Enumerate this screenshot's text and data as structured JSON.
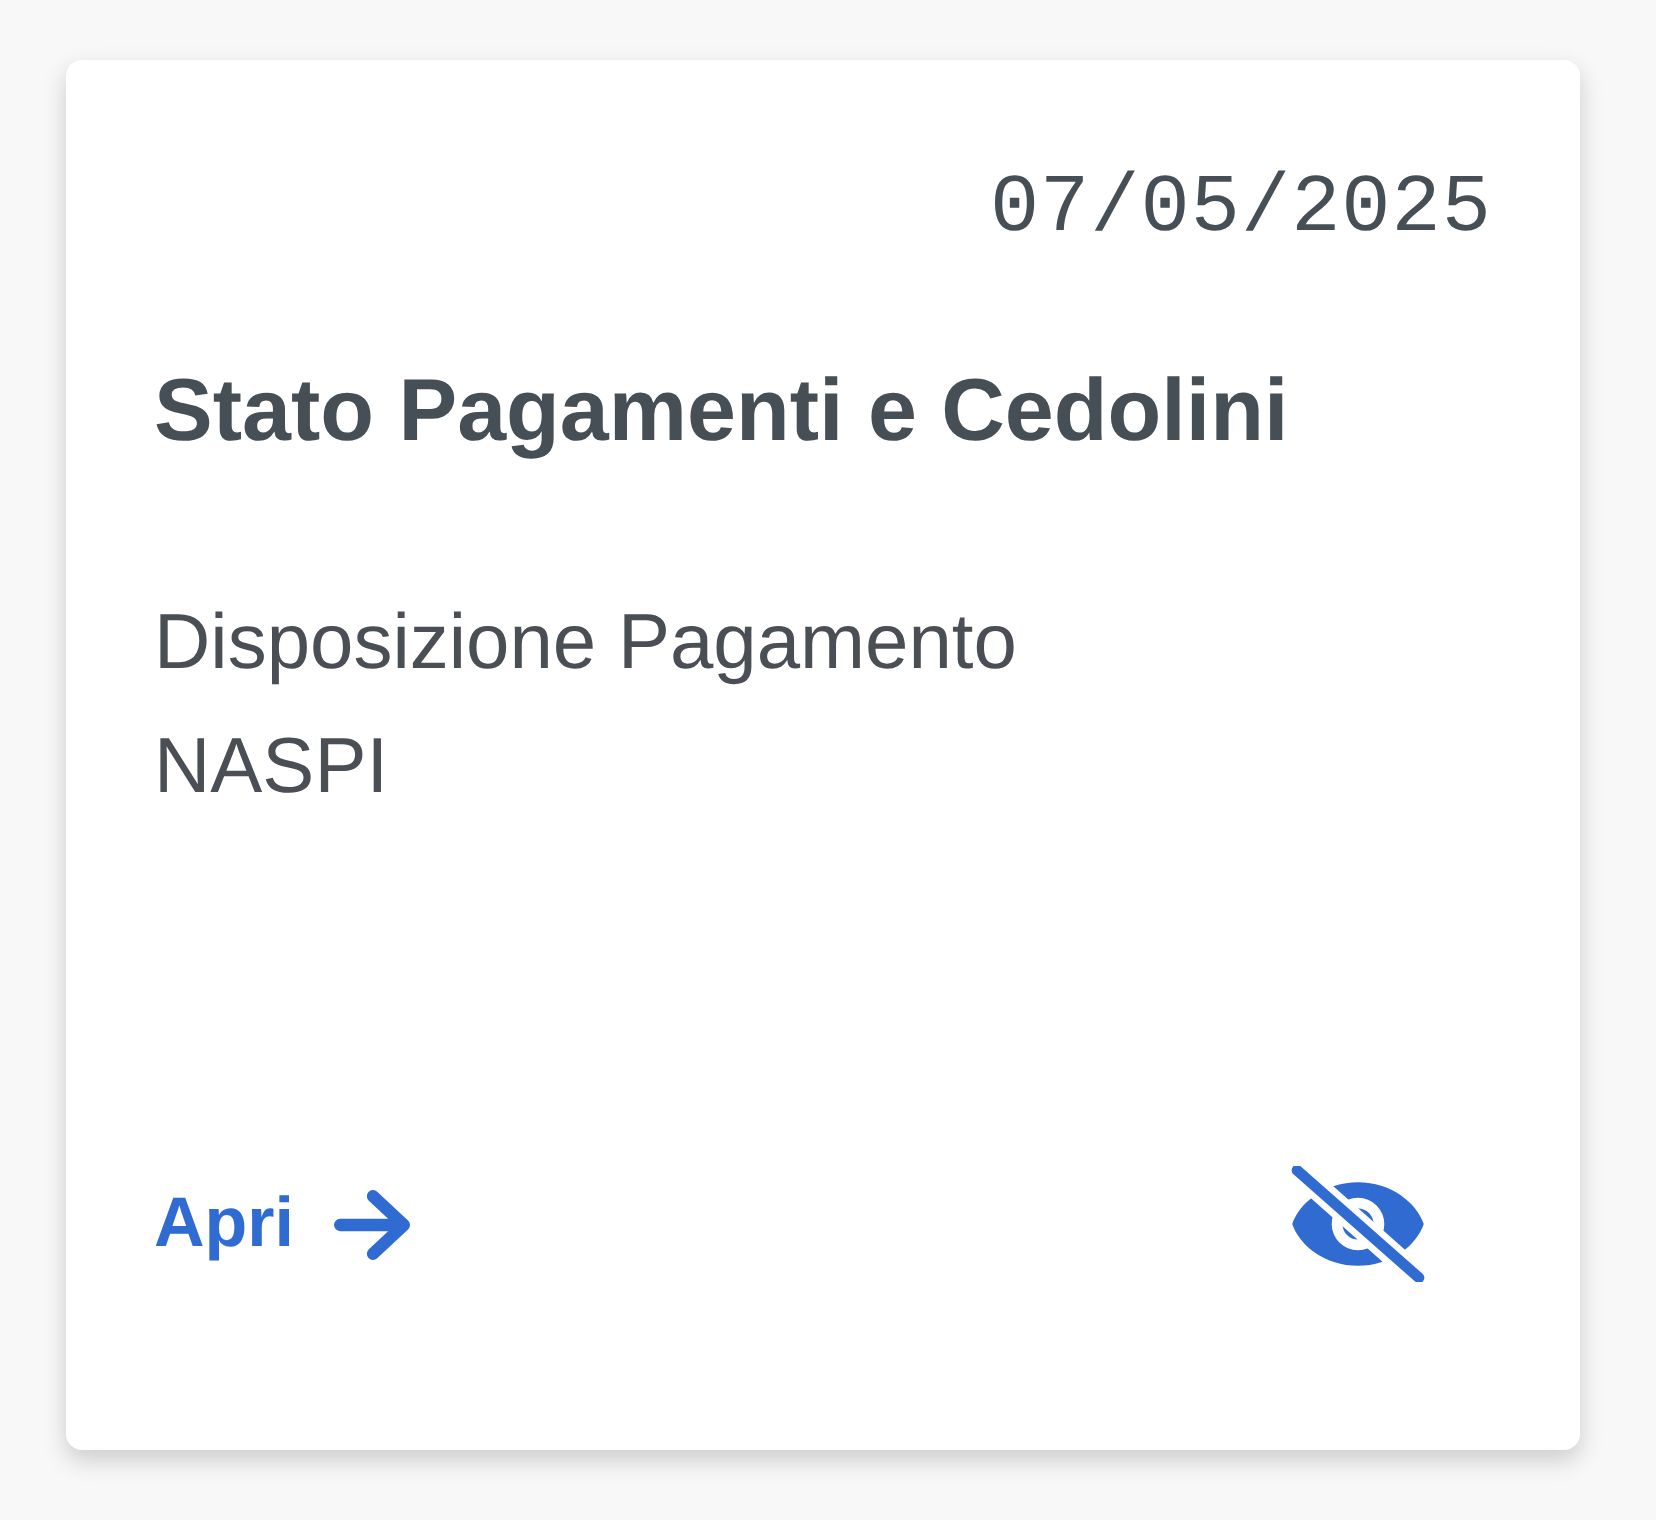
{
  "card": {
    "date": "07/05/2025",
    "title": "Stato Pagamenti e Cedolini",
    "description_lines": [
      "Disposizione Pagamento",
      "NASPI"
    ],
    "action": {
      "label": "Apri"
    },
    "visibility_toggle": {
      "visible": false
    }
  }
}
